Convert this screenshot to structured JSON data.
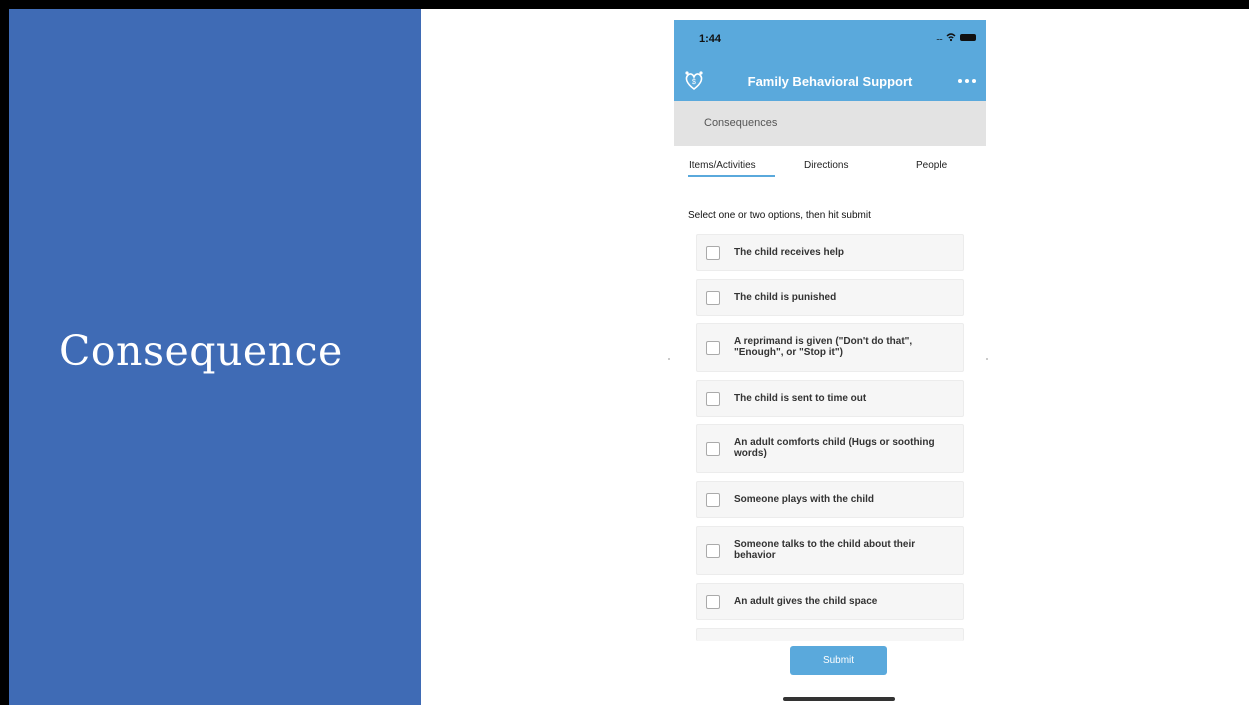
{
  "slide": {
    "title": "Consequence"
  },
  "status_bar": {
    "time": "1:44"
  },
  "app": {
    "title": "Family Behavioral Support",
    "section": "Consequences"
  },
  "tabs": [
    {
      "label": "Items/Activities",
      "active": true
    },
    {
      "label": "Directions",
      "active": false
    },
    {
      "label": "People",
      "active": false
    }
  ],
  "form": {
    "instructions": "Select one or two options, then hit submit",
    "options": [
      "The child receives help",
      "The child is punished",
      "A reprimand is given (\"Don't do that\", \"Enough\", or \"Stop it\")",
      "The child is sent to time out",
      "An adult comforts child (Hugs or soothing words)",
      "Someone plays with the child",
      "Someone talks to the child about their behavior",
      "An adult gives the child space"
    ],
    "submit_label": "Submit"
  },
  "colors": {
    "slide_panel": "#3f6bb5",
    "app_header": "#5aa9dc",
    "section_bar": "#e3e3e3"
  }
}
